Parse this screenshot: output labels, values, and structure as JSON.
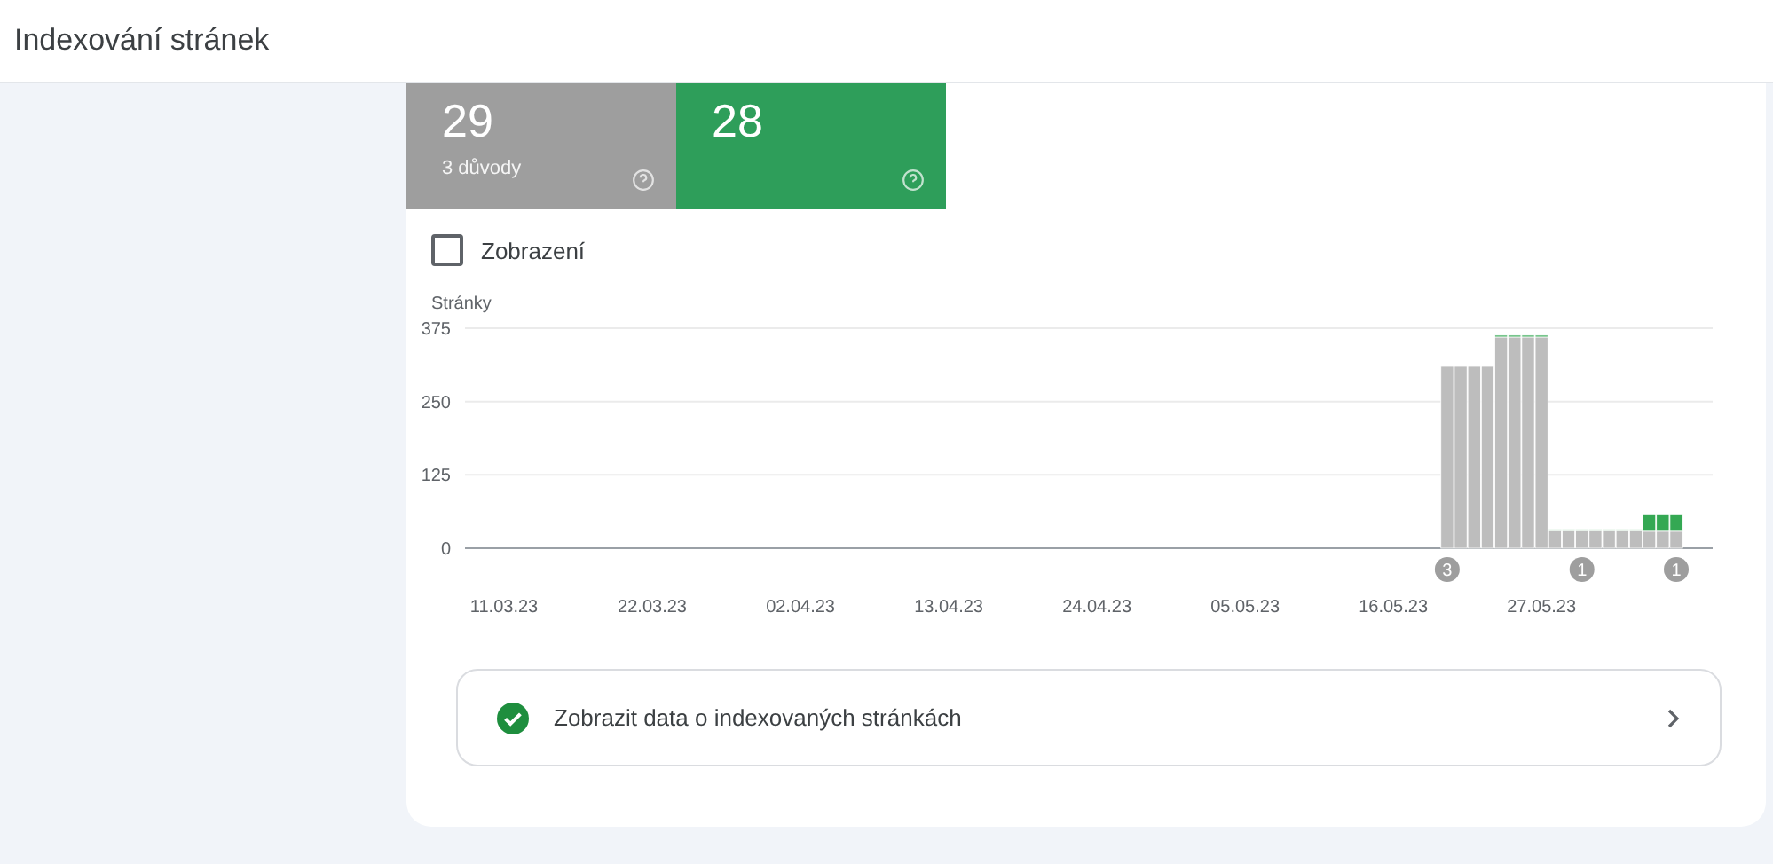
{
  "header": {
    "title": "Indexování stránek"
  },
  "summary_cards": [
    {
      "value": "29",
      "subtitle": "3 důvody",
      "color": "#9e9e9e"
    },
    {
      "value": "28",
      "color": "#2e9e5a"
    }
  ],
  "impressions_toggle": {
    "label": "Zobrazení",
    "checked": false
  },
  "chart_data": {
    "type": "bar",
    "stacked": true,
    "ylabel": "Stránky",
    "ylim": [
      0,
      375
    ],
    "yticks": [
      0,
      125,
      250,
      375
    ],
    "categories": [
      "11.03.23",
      null,
      null,
      null,
      null,
      null,
      null,
      null,
      null,
      null,
      null,
      "22.03.23",
      null,
      null,
      null,
      null,
      null,
      null,
      null,
      null,
      null,
      null,
      "02.04.23",
      null,
      null,
      null,
      null,
      null,
      null,
      null,
      null,
      null,
      null,
      "13.04.23",
      null,
      null,
      null,
      null,
      null,
      null,
      null,
      null,
      null,
      null,
      "24.04.23",
      null,
      null,
      null,
      null,
      null,
      null,
      null,
      null,
      null,
      null,
      "05.05.23",
      null,
      null,
      null,
      null,
      null,
      null,
      null,
      null,
      null,
      null,
      "16.05.23",
      null,
      null,
      null,
      null,
      null,
      null,
      null,
      null,
      null,
      null,
      "27.05.23",
      null,
      null,
      null,
      null,
      null,
      null,
      null,
      null,
      null,
      null
    ],
    "series": [
      {
        "color": "#bdbdbd",
        "values": [
          null,
          null,
          null,
          null,
          null,
          null,
          null,
          null,
          null,
          null,
          null,
          null,
          null,
          null,
          null,
          null,
          null,
          null,
          null,
          null,
          null,
          null,
          null,
          null,
          null,
          null,
          null,
          null,
          null,
          null,
          null,
          null,
          null,
          null,
          null,
          null,
          null,
          null,
          null,
          null,
          null,
          null,
          null,
          null,
          null,
          null,
          null,
          null,
          null,
          null,
          null,
          null,
          null,
          null,
          null,
          null,
          null,
          null,
          null,
          null,
          null,
          null,
          null,
          null,
          null,
          null,
          null,
          null,
          null,
          null,
          310,
          310,
          310,
          310,
          360,
          360,
          360,
          360,
          30,
          30,
          30,
          30,
          30,
          30,
          30,
          29,
          29,
          29
        ]
      },
      {
        "color": "#34a853",
        "values": [
          null,
          null,
          null,
          null,
          null,
          null,
          null,
          null,
          null,
          null,
          null,
          null,
          null,
          null,
          null,
          null,
          null,
          null,
          null,
          null,
          null,
          null,
          null,
          null,
          null,
          null,
          null,
          null,
          null,
          null,
          null,
          null,
          null,
          null,
          null,
          null,
          null,
          null,
          null,
          null,
          null,
          null,
          null,
          null,
          null,
          null,
          null,
          null,
          null,
          null,
          null,
          null,
          null,
          null,
          null,
          null,
          null,
          null,
          null,
          null,
          null,
          null,
          null,
          null,
          null,
          null,
          null,
          null,
          null,
          null,
          0,
          0,
          0,
          0,
          3,
          3,
          3,
          3,
          2,
          2,
          2,
          2,
          2,
          2,
          2,
          28,
          28,
          28
        ]
      }
    ],
    "annotations": [
      "3",
      "1",
      "1"
    ]
  },
  "details_link": {
    "label": "Zobrazit data o indexovaných stránkách"
  }
}
